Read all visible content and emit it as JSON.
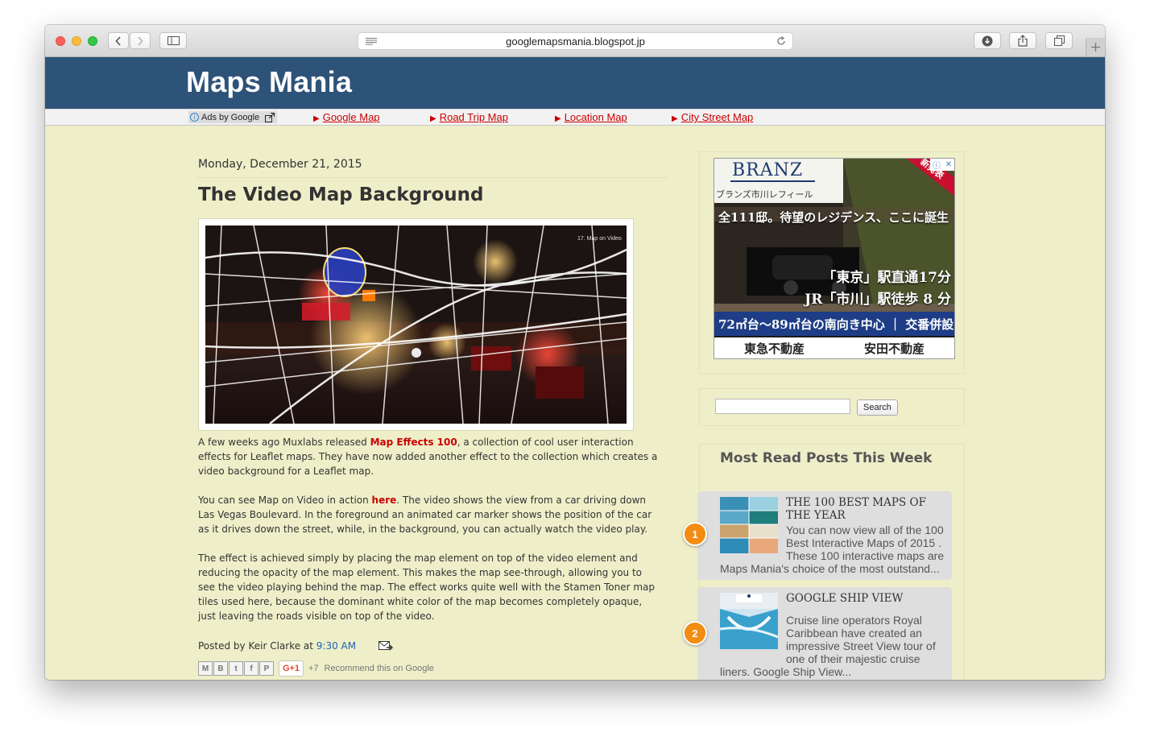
{
  "browser": {
    "url": "googlemapsmania.blogspot.jp"
  },
  "blog": {
    "title": "Maps Mania"
  },
  "adbar": {
    "ads_by": "Ads by Google",
    "links": [
      "Google Map",
      "Road Trip Map",
      "Location Map",
      "City Street Map"
    ],
    "link_color": "#cc0000"
  },
  "post": {
    "date": "Monday, December 21, 2015",
    "title": "The Video Map Background",
    "p1_a": "A few weeks ago Muxlabs released ",
    "p1_link": "Map Effects 100",
    "p1_b": ", a collection of cool user interaction effects for Leaflet maps. They have now added another effect to the collection which creates a video background for a Leaflet map.",
    "p2_a": "You can see Map on Video in action ",
    "p2_link": "here",
    "p2_b": ". The video shows the view from a car driving down Las Vegas Boulevard. In the foreground an animated car marker shows the position of the car as it drives down the street, while, in the background, you can actually watch the video play.",
    "p3": "The effect is achieved simply by placing the map element on top of the video element and reducing the opacity of the map element. This makes the map see-through, allowing you to see the video playing behind the map. The effect works quite well with the Stamen Toner map tiles used here, because the dominant white color of the map becomes completely opaque, just leaving the roads visible on top of the video.",
    "posted_by": "Posted by Keir Clarke at ",
    "time": "9:30 AM",
    "image_label": "17. Map on Video",
    "share": {
      "gplus_label": "G+1",
      "plus_count": "+7",
      "recommend": "Recommend this on Google"
    }
  },
  "ad": {
    "brand": "BRANZ",
    "sub": "ブランズ市川レフィール",
    "headline": "全111邸。待望のレジデンス、ここに誕生",
    "badge": "新発表",
    "line1": "「東京」駅直通17分",
    "line2": "JR「市川」駅徒歩 8 分",
    "band": "72㎡台〜89㎡台の南向き中心 ｜ 交番併設",
    "sponsor1": "東急不動産",
    "sponsor2": "安田不動産"
  },
  "search": {
    "button": "Search",
    "value": ""
  },
  "popular": {
    "title": "Most Read Posts This Week",
    "items": [
      {
        "rank": "1",
        "title": "THE 100 BEST MAPS OF THE YEAR",
        "snippet": "You can now view all of the 100 Best Interactive Maps of 2015 . These 100 interactive maps are",
        "snippet_tail": "Maps Mania's choice of the most outstand..."
      },
      {
        "rank": "2",
        "title": "GOOGLE SHIP VIEW",
        "snippet": "Cruise line operators Royal Caribbean have created an impressive Street View tour of one of their majestic cruise",
        "snippet_tail": "liners. Google Ship View..."
      }
    ]
  }
}
